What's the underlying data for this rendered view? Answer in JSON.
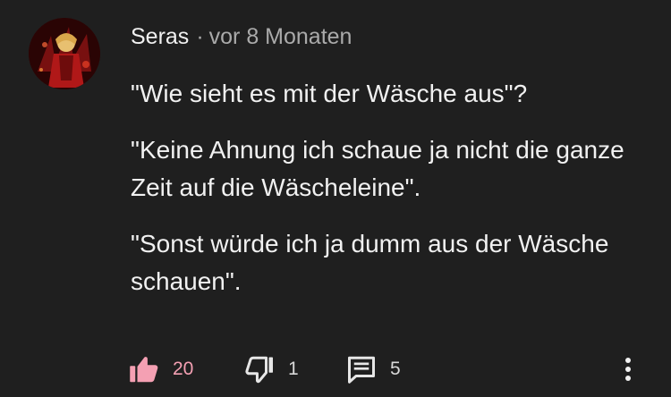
{
  "comment": {
    "author": "Seras",
    "separator": "·",
    "time": "vor 8 Monaten",
    "paragraphs": [
      "\"Wie sieht es mit der Wäsche aus\"?",
      "\"Keine Ahnung ich schaue ja nicht die ganze Zeit auf die Wäscheleine\".",
      "\"Sonst würde ich ja dumm aus der Wäsche schauen\"."
    ]
  },
  "actions": {
    "likes": "20",
    "dislikes": "1",
    "replies": "5",
    "like_color": "#f4a0b3",
    "like_icon": "thumbs-up-icon",
    "dislike_icon": "thumbs-down-icon",
    "reply_icon": "reply-icon",
    "more_icon": "more-vertical-icon"
  }
}
